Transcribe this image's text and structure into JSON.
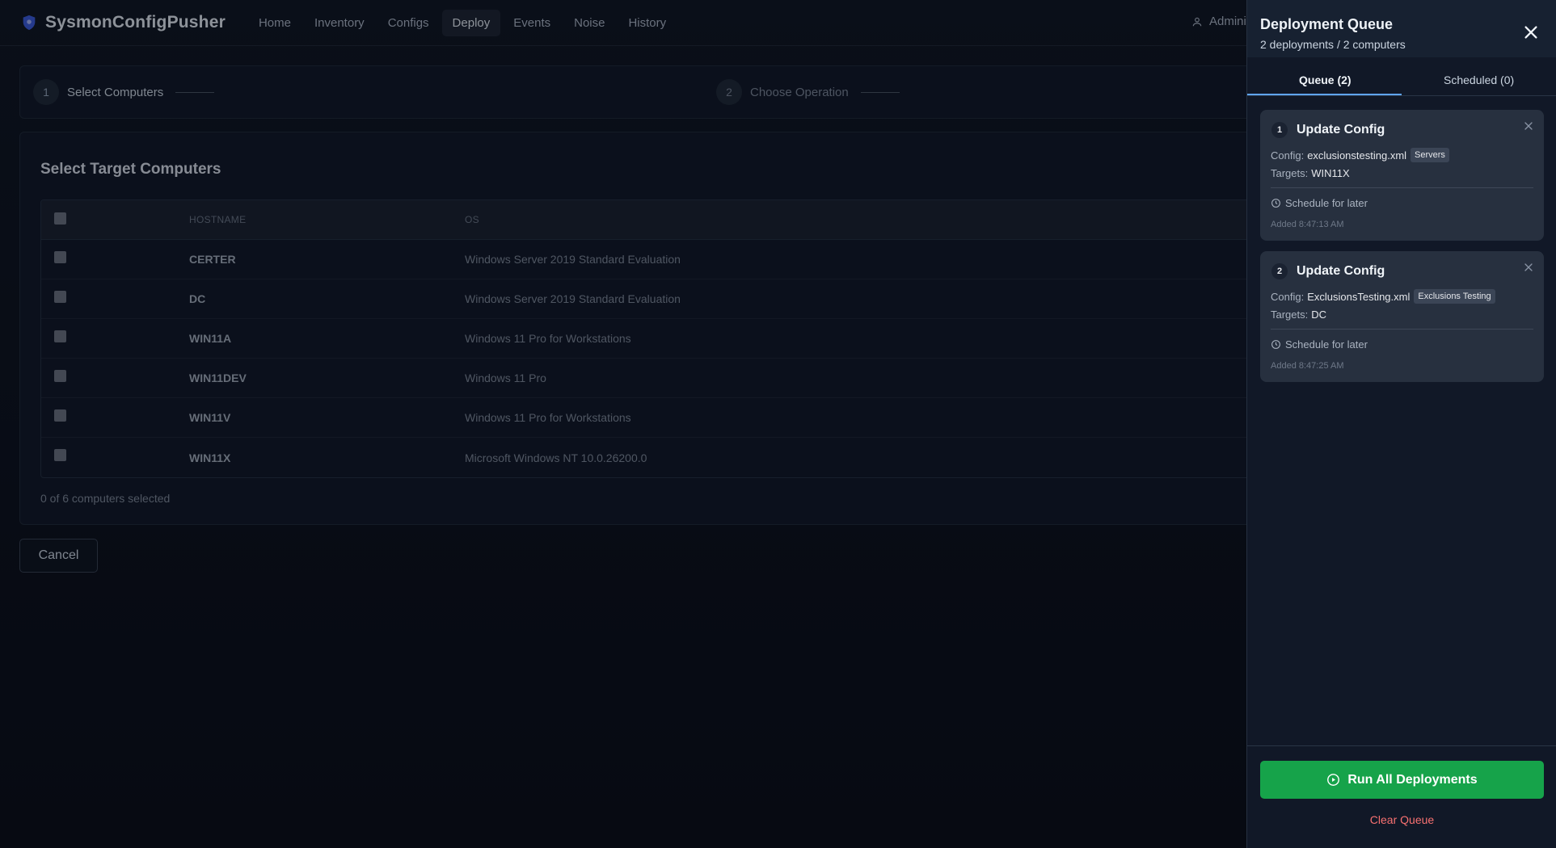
{
  "app": {
    "name": "SysmonConfigPusher",
    "user": "Admini"
  },
  "nav": [
    {
      "label": "Home",
      "active": false
    },
    {
      "label": "Inventory",
      "active": false
    },
    {
      "label": "Configs",
      "active": false
    },
    {
      "label": "Deploy",
      "active": true
    },
    {
      "label": "Events",
      "active": false
    },
    {
      "label": "Noise",
      "active": false
    },
    {
      "label": "History",
      "active": false
    }
  ],
  "stepper": [
    {
      "number": "1",
      "label": "Select Computers"
    },
    {
      "number": "2",
      "label": "Choose Operation"
    }
  ],
  "panel": {
    "title": "Select Target Computers",
    "columns": {
      "hostname": "HOSTNAME",
      "os": "OS"
    },
    "rows": [
      {
        "hostname": "CERTER",
        "os": "Windows Server 2019 Standard Evaluation",
        "checked": false
      },
      {
        "hostname": "DC",
        "os": "Windows Server 2019 Standard Evaluation",
        "checked": false
      },
      {
        "hostname": "WIN11A",
        "os": "Windows 11 Pro for Workstations",
        "checked": false
      },
      {
        "hostname": "WIN11DEV",
        "os": "Windows 11 Pro",
        "checked": false
      },
      {
        "hostname": "WIN11V",
        "os": "Windows 11 Pro for Workstations",
        "checked": false
      },
      {
        "hostname": "WIN11X",
        "os": "Microsoft Windows NT 10.0.26200.0",
        "checked": false
      }
    ],
    "selection_text": "0 of 6 computers selected",
    "cancel_label": "Cancel"
  },
  "drawer": {
    "title": "Deployment Queue",
    "subtitle": "2 deployments / 2 computers",
    "tabs": [
      {
        "label": "Queue (2)",
        "active": true
      },
      {
        "label": "Scheduled (0)",
        "active": false
      }
    ],
    "items": [
      {
        "number": "1",
        "title": "Update Config",
        "config_label": "Config:",
        "config": "exclusionstesting.xml",
        "tag": "Servers",
        "targets_label": "Targets:",
        "targets": "WIN11X",
        "schedule_label": "Schedule for later",
        "added": "Added 8:47:13 AM"
      },
      {
        "number": "2",
        "title": "Update Config",
        "config_label": "Config:",
        "config": "ExclusionsTesting.xml",
        "tag": "Exclusions Testing",
        "targets_label": "Targets:",
        "targets": "DC",
        "schedule_label": "Schedule for later",
        "added": "Added 8:47:25 AM"
      }
    ],
    "run_label": "Run All Deployments",
    "clear_label": "Clear Queue"
  },
  "colors": {
    "accent_blue": "#60a5fa",
    "run_green": "#16a34a",
    "danger_red": "#f87171",
    "background": "#0b0f19"
  },
  "icons": {
    "logo": "shield-icon",
    "user": "user-icon",
    "close": "close-icon",
    "remove": "x-icon",
    "schedule": "clock-icon",
    "run": "play-circle-icon"
  }
}
